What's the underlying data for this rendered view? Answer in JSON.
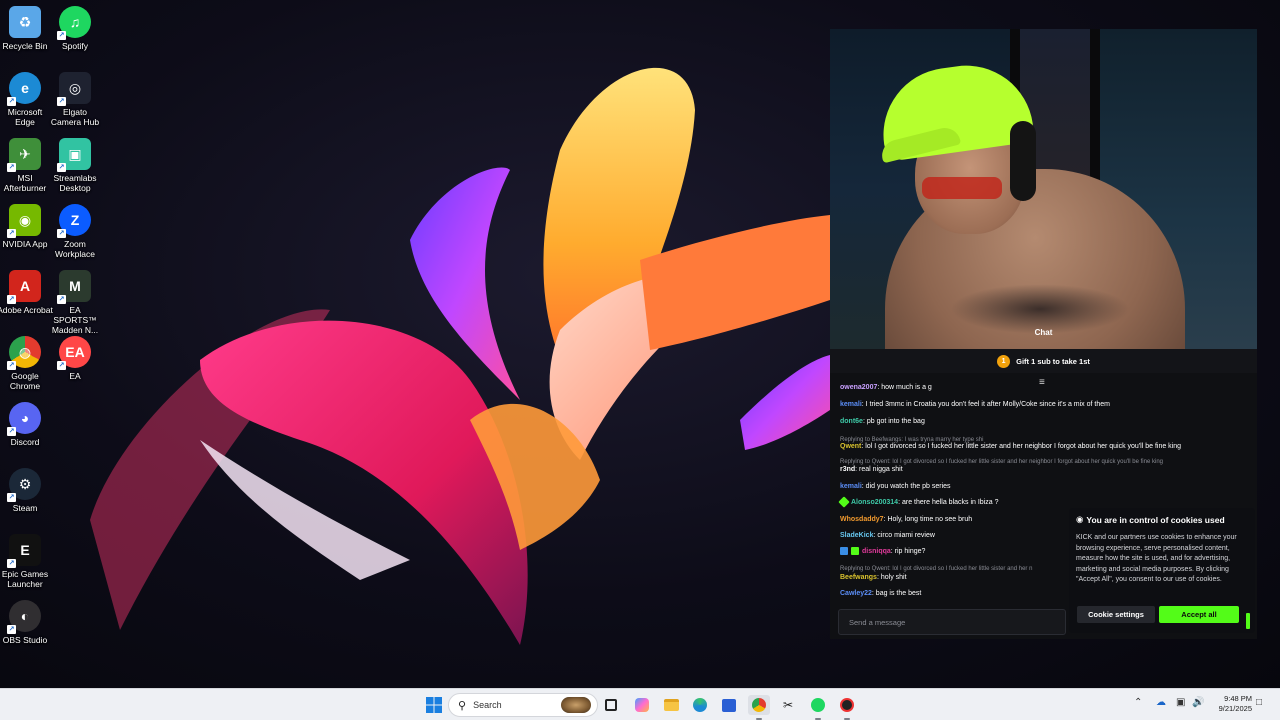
{
  "desktop": {
    "icons": [
      {
        "label": "Recycle Bin",
        "icon": "recycle-bin-icon",
        "color": "#5aa7e8"
      },
      {
        "label": "Spotify",
        "icon": "spotify-icon",
        "color": "#1ed760"
      },
      {
        "label": "Microsoft Edge",
        "icon": "edge-icon",
        "color": "#1c8ad4"
      },
      {
        "label": "Elgato Camera Hub",
        "icon": "elgato-camera-hub-icon",
        "color": "#1e2230"
      },
      {
        "label": "MSI Afterburner",
        "icon": "msi-afterburner-icon",
        "color": "#3f8f3a"
      },
      {
        "label": "Streamlabs Desktop",
        "icon": "streamlabs-icon",
        "color": "#31c3a2"
      },
      {
        "label": "NVIDIA App",
        "icon": "nvidia-icon",
        "color": "#76b900"
      },
      {
        "label": "Zoom Workplace",
        "icon": "zoom-icon",
        "color": "#0b5cff"
      },
      {
        "label": "Adobe Acrobat",
        "icon": "adobe-acrobat-icon",
        "color": "#d2251c"
      },
      {
        "label": "EA SPORTS™ Madden N...",
        "icon": "madden-icon",
        "color": "#2b3a2e"
      },
      {
        "label": "Google Chrome",
        "icon": "chrome-icon",
        "color": "#e6b714"
      },
      {
        "label": "EA",
        "icon": "ea-icon",
        "color": "#ff4747"
      },
      {
        "label": "Discord",
        "icon": "discord-icon",
        "color": "#5865f2"
      },
      {
        "label": "Steam",
        "icon": "steam-icon",
        "color": "#1b2838"
      },
      {
        "label": "Epic Games Launcher",
        "icon": "epic-games-icon",
        "color": "#111111"
      },
      {
        "label": "OBS Studio",
        "icon": "obs-studio-icon",
        "color": "#302e31"
      }
    ]
  },
  "stream": {
    "video_label": "Chat",
    "gift": {
      "badge": "1",
      "text": "Gift 1 sub to take 1st"
    },
    "messages": [
      {
        "user": "owena2007",
        "color": "#c9a0ff",
        "text": ": how much is a g"
      },
      {
        "user": "kemali",
        "color": "#5b8ef7",
        "text": ": I tried 3mmc in Croatia you don't feel it after Molly/Coke since it's a mix of them"
      },
      {
        "user": "dont6e",
        "color": "#3ec9a7",
        "text": ": pb got into the bag"
      },
      {
        "reply": "Replying to Beefwangs: I was tryna marry her type shi"
      },
      {
        "user": "Qwent",
        "color": "#d9c22e",
        "text": ": lol I got divorced so I fucked her little sister and her neighbor I forgot about her quick you'll be fine king"
      },
      {
        "reply": "Replying to Qwent: lol I got divorced so I fucked her little sister and her neighbor I forgot about her quick you'll be fine king"
      },
      {
        "user": "r3nd",
        "color": "#ffffff",
        "text": ": real nigga shit"
      },
      {
        "user": "kemali",
        "color": "#5b8ef7",
        "text": ": did you watch the pb series"
      },
      {
        "user": "Alonso200314",
        "color": "#3ec9a7",
        "text": ": are there hella blacks in Ibiza ?"
      },
      {
        "user": "Whosdaddy7",
        "color": "#f29a2e",
        "text": ": Holy, long time no see bruh"
      },
      {
        "user": "SladeKick",
        "color": "#67c7ef",
        "text": ": circo miami review"
      },
      {
        "user": "disniqqa",
        "color": "#e03a9a",
        "text": ": rip hinge?"
      },
      {
        "reply": "Replying to Qwent: lol I got divorced so I fucked her little sister and her n"
      },
      {
        "user": "Beefwangs",
        "color": "#d9c22e",
        "text": ": holy shit"
      },
      {
        "user": "Cawley22",
        "color": "#5b8ef7",
        "text": ": bag is the best"
      }
    ],
    "send_placeholder": "Send a message"
  },
  "cookie": {
    "title": "You are in control of cookies used",
    "body": "KICK and our partners use cookies to enhance your browsing experience, serve personalised content, measure how the site is used, and for advertising, marketing and social media purposes. By clicking \"Accept All\", you consent to our use of cookies.",
    "settings_label": "Cookie settings",
    "accept_label": "Accept all",
    "accent": "#53fc18"
  },
  "taskbar": {
    "search_label": "Search",
    "apps": [
      "start-icon",
      "task-view-icon",
      "copilot-icon",
      "file-explorer-icon",
      "edge-icon",
      "store-icon",
      "chrome-icon",
      "snipping-icon",
      "spotify-icon",
      "app-icon"
    ],
    "clock": {
      "time": "9:48 PM",
      "date": "9/21/2025"
    }
  }
}
